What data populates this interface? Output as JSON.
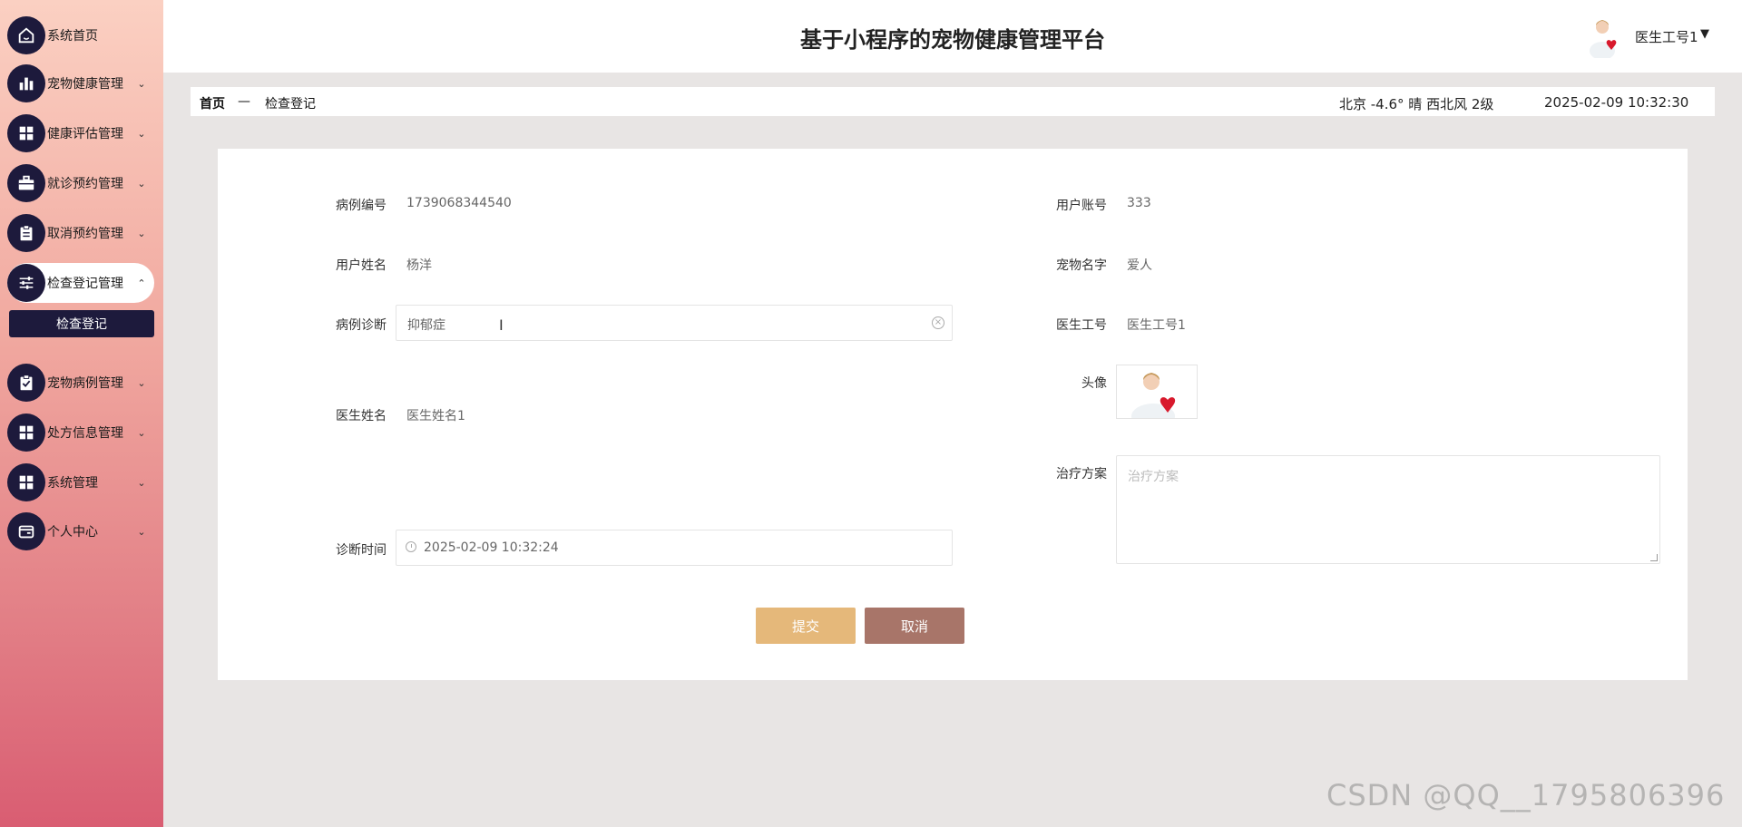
{
  "header": {
    "title": "基于小程序的宠物健康管理平台",
    "user_name": "医生工号1",
    "caret": "▼"
  },
  "sidebar": {
    "items": [
      {
        "label": "系统首页",
        "arrow": ""
      },
      {
        "label": "宠物健康管理",
        "arrow": "⌄"
      },
      {
        "label": "健康评估管理",
        "arrow": "⌄"
      },
      {
        "label": "就诊预约管理",
        "arrow": "⌄"
      },
      {
        "label": "取消预约管理",
        "arrow": "⌄"
      },
      {
        "label": "检查登记管理",
        "arrow": "⌃"
      },
      {
        "label": "宠物病例管理",
        "arrow": "⌄"
      },
      {
        "label": "处方信息管理",
        "arrow": "⌄"
      },
      {
        "label": "系统管理",
        "arrow": "⌄"
      },
      {
        "label": "个人中心",
        "arrow": "⌄"
      }
    ],
    "submenu": {
      "label": "检查登记"
    }
  },
  "breadcrumb": {
    "home": "首页",
    "separator": "—",
    "current": "检查登记"
  },
  "status": {
    "weather": "北京  -4.6°  晴  西北风  2级",
    "datetime": "2025-02-09 10:32:30"
  },
  "form": {
    "case_no": {
      "label": "病例编号",
      "value": "1739068344540"
    },
    "user_account": {
      "label": "用户账号",
      "value": "333"
    },
    "user_name": {
      "label": "用户姓名",
      "value": "杨洋"
    },
    "pet_name": {
      "label": "宠物名字",
      "value": "爱人"
    },
    "diagnosis": {
      "label": "病例诊断",
      "value": "抑郁症"
    },
    "doctor_id": {
      "label": "医生工号",
      "value": "医生工号1"
    },
    "avatar": {
      "label": "头像"
    },
    "doctor_name": {
      "label": "医生姓名",
      "value": "医生姓名1"
    },
    "treatment": {
      "label": "治疗方案",
      "placeholder": "治疗方案"
    },
    "diagnosis_time": {
      "label": "诊断时间",
      "value": "2025-02-09 10:32:24"
    },
    "submit_label": "提交",
    "cancel_label": "取消"
  },
  "watermark": "CSDN @QQ__1795806396",
  "colors": {
    "sidebar_dark": "#1d1a3c",
    "submit": "#e5b87a",
    "cancel": "#a87569"
  }
}
